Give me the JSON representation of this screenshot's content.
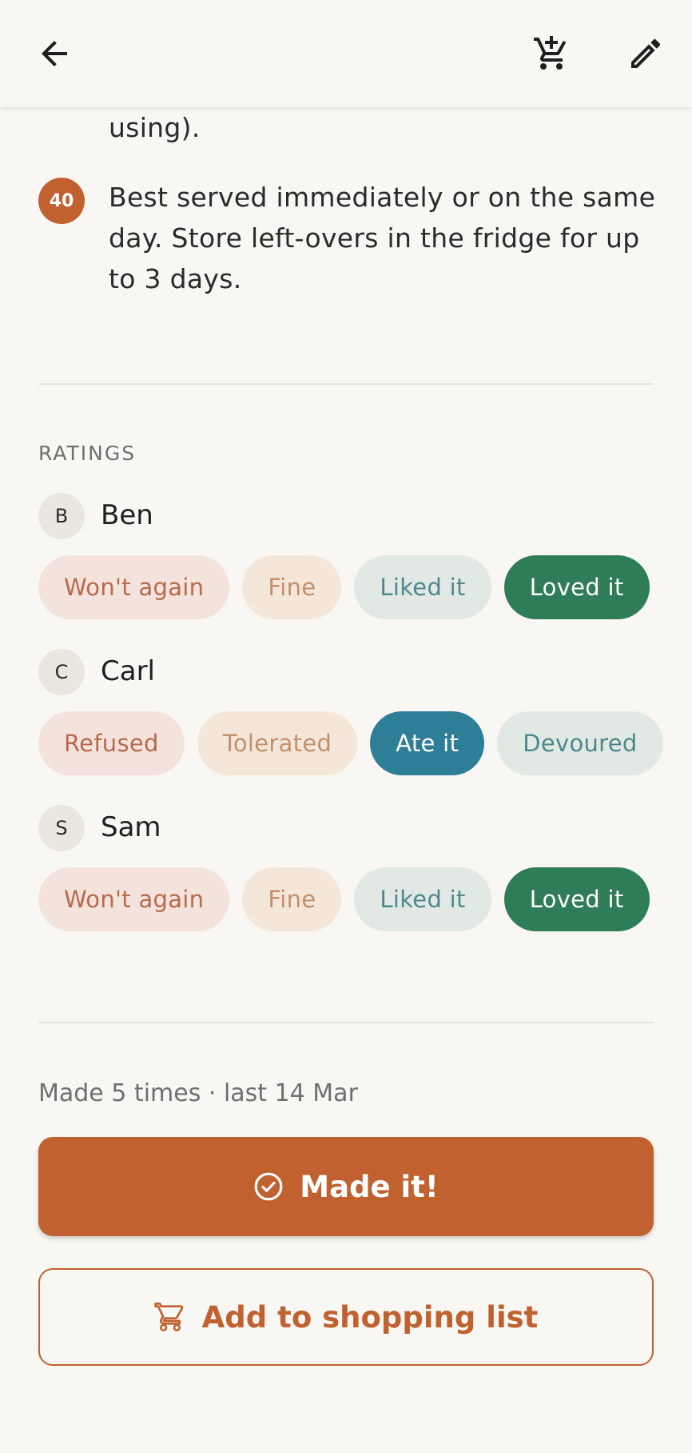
{
  "toolbar": {
    "back_icon": "arrow-back-icon",
    "cart_icon": "cart-add-icon",
    "edit_icon": "pencil-icon"
  },
  "steps": {
    "partial_text": "using).",
    "last_step": {
      "number": "40",
      "text": "Best served immediately or on the same day. Store left-overs in the fridge for up to 3 days."
    }
  },
  "ratings": {
    "title": "RATINGS",
    "people": [
      {
        "initial": "B",
        "name": "Ben",
        "options": [
          "Won't again",
          "Fine",
          "Liked it",
          "Loved it"
        ],
        "selected": "Loved it"
      },
      {
        "initial": "C",
        "name": "Carl",
        "options": [
          "Refused",
          "Tolerated",
          "Ate it",
          "Devoured"
        ],
        "selected": "Ate it"
      },
      {
        "initial": "S",
        "name": "Sam",
        "options": [
          "Won't again",
          "Fine",
          "Liked it",
          "Loved it"
        ],
        "selected": "Loved it"
      }
    ]
  },
  "footer": {
    "made_info": "Made 5 times · last 14 Mar",
    "made_button": "Made it!",
    "shopping_button": "Add to shopping list"
  },
  "colors": {
    "accent": "#C0612F",
    "selected_green": "#2E7D57",
    "selected_teal": "#2E7E98",
    "background": "#F8F7F3"
  }
}
